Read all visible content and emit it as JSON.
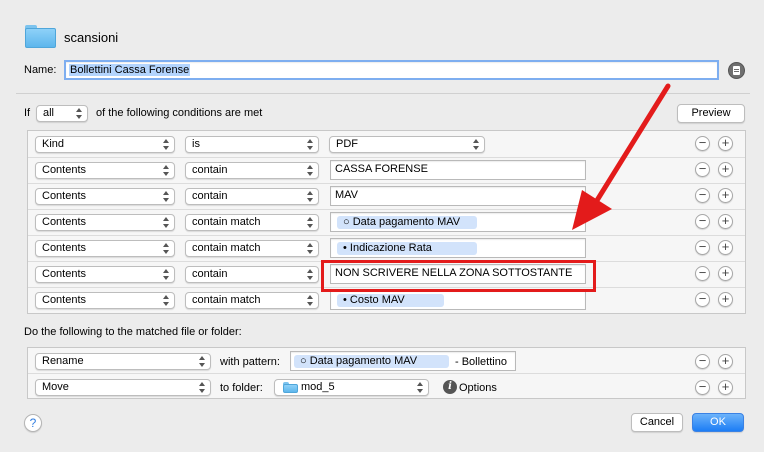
{
  "header": {
    "folder_name": "scansioni",
    "name_label": "Name:",
    "name_value": "Bollettini Cassa Forense"
  },
  "conditions": {
    "if_label": "If",
    "match_value": "all",
    "suffix": "of the following conditions are met",
    "preview_label": "Preview",
    "rows": [
      {
        "attribute": "Kind",
        "operator": "is",
        "value_type": "popup",
        "value": "PDF"
      },
      {
        "attribute": "Contents",
        "operator": "contain",
        "value_type": "text",
        "value": "CASSA FORENSE"
      },
      {
        "attribute": "Contents",
        "operator": "contain",
        "value_type": "text",
        "value": "MAV"
      },
      {
        "attribute": "Contents",
        "operator": "contain match",
        "value_type": "token",
        "token_marker": "○",
        "value": "Data pagamento MAV"
      },
      {
        "attribute": "Contents",
        "operator": "contain match",
        "value_type": "token",
        "token_marker": "•",
        "value": "Indicazione Rata"
      },
      {
        "attribute": "Contents",
        "operator": "contain",
        "value_type": "text",
        "value": "NON SCRIVERE NELLA ZONA SOTTOSTANTE",
        "highlighted": true
      },
      {
        "attribute": "Contents",
        "operator": "contain match",
        "value_type": "token",
        "token_marker": "•",
        "value": "Costo MAV"
      }
    ],
    "remove_glyph": "−",
    "add_glyph": "+"
  },
  "actions": {
    "heading": "Do the following to the matched file or folder:",
    "rename": {
      "action": "Rename",
      "pattern_label": "with pattern:",
      "token_marker": "○",
      "token": "Data pagamento MAV",
      "suffix": "- Bollettino"
    },
    "move": {
      "action": "Move",
      "folder_label": "to folder:",
      "folder": "mod_5",
      "options_label": "Options"
    }
  },
  "footer": {
    "help_glyph": "?",
    "cancel_label": "Cancel",
    "ok_label": "OK"
  },
  "icons": {
    "folder": "folder-icon",
    "name_info": "document-info-icon",
    "info": "info-icon",
    "help": "help-icon",
    "arrow": "red-arrow-annotation"
  },
  "colors": {
    "accent": "#1d7df5",
    "token_bg": "#d2e3fb",
    "annotation_red": "#e31b1b"
  }
}
